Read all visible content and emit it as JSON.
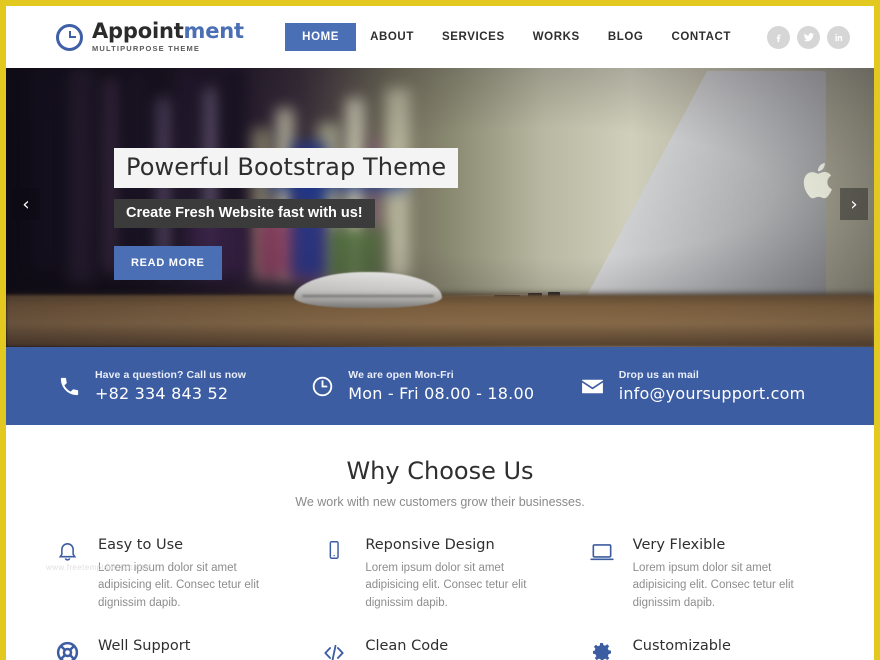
{
  "theme": {
    "frame_color": "#e3c91f",
    "accent_blue": "#4a6fb5",
    "info_bar_blue": "#3d5da3"
  },
  "header": {
    "brand": {
      "name_part1": "Appoint",
      "name_part2": "ment",
      "tagline": "MULTIPURPOSE THEME",
      "logo_icon": "clock-icon"
    },
    "nav": [
      {
        "label": "HOME",
        "active": true
      },
      {
        "label": "ABOUT",
        "active": false
      },
      {
        "label": "SERVICES",
        "active": false
      },
      {
        "label": "WORKS",
        "active": false
      },
      {
        "label": "BLOG",
        "active": false
      },
      {
        "label": "CONTACT",
        "active": false
      }
    ],
    "social": [
      {
        "name": "facebook-icon"
      },
      {
        "name": "twitter-icon"
      },
      {
        "name": "linkedin-icon"
      }
    ]
  },
  "hero": {
    "title": "Powerful Bootstrap Theme",
    "subtitle": "Create Fresh Website fast with us!",
    "button_label": "READ MORE",
    "prev_label": "‹",
    "next_label": "›"
  },
  "info_bar": [
    {
      "icon": "phone-icon",
      "label": "Have a question? Call us now",
      "value": "+82 334 843 52"
    },
    {
      "icon": "clock-icon",
      "label": "We are open Mon-Fri",
      "value": "Mon - Fri 08.00 - 18.00"
    },
    {
      "icon": "envelope-icon",
      "label": "Drop us an mail",
      "value": "info@yoursupport.com"
    }
  ],
  "features_section": {
    "title": "Why Choose Us",
    "subtitle": "We work with new customers grow their businesses.",
    "watermark": "www.freetemplatespot.com",
    "items": [
      {
        "icon": "bell-icon",
        "title": "Easy to Use",
        "text": "Lorem ipsum dolor sit amet adipisicing elit. Consec tetur elit dignissim dapib."
      },
      {
        "icon": "mobile-icon",
        "title": "Reponsive Design",
        "text": "Lorem ipsum dolor sit amet adipisicing elit. Consec tetur elit dignissim dapib."
      },
      {
        "icon": "laptop-icon",
        "title": "Very Flexible",
        "text": "Lorem ipsum dolor sit amet adipisicing elit. Consec tetur elit dignissim dapib."
      },
      {
        "icon": "lifebuoy-icon",
        "title": "Well Support",
        "text": ""
      },
      {
        "icon": "code-icon",
        "title": "Clean Code",
        "text": ""
      },
      {
        "icon": "gear-icon",
        "title": "Customizable",
        "text": ""
      }
    ]
  }
}
